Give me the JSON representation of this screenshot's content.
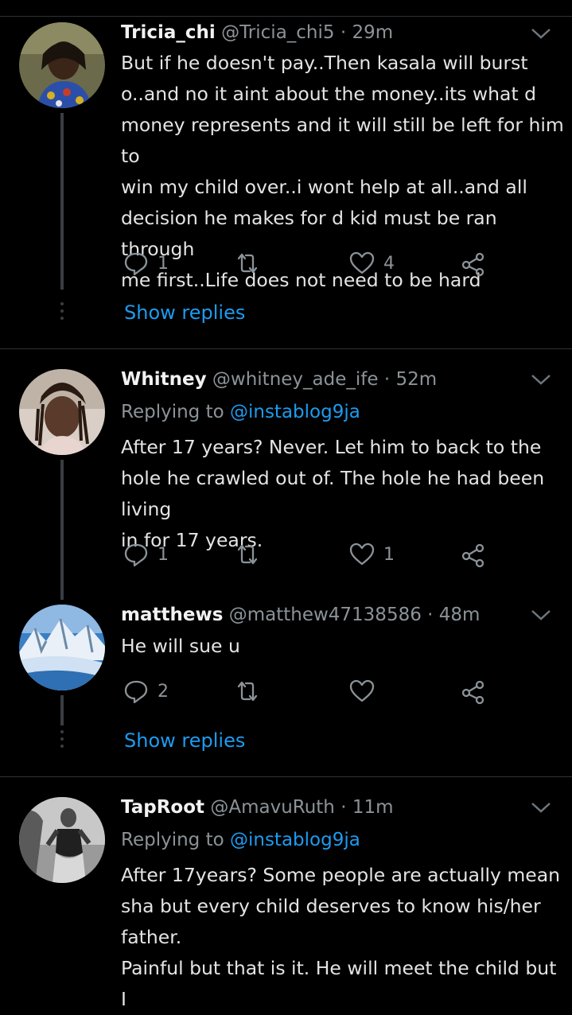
{
  "colors": {
    "background": "#000000",
    "link": "#1d9bf0",
    "muted": "#8b9398",
    "text": "#e4e4e4"
  },
  "tweets": [
    {
      "name": "Tricia_chi",
      "meta": "@Tricia_chi5 · 29m",
      "reply_to_label": "",
      "reply_to_handle": "",
      "lines": [
        "But if he doesn't pay..Then kasala will burst",
        "o..and no it aint about the money..its what d",
        "money represents and it will still be left for him to",
        "win my child over..i wont help at all..and all",
        "decision he makes for d kid must be ran through",
        "me first..Life does not need to be hard"
      ],
      "reply_count": "1",
      "retweet_count": "",
      "like_count": "4",
      "show_replies": "Show replies"
    },
    {
      "name": "Whitney",
      "meta": "@whitney_ade_ife · 52m",
      "reply_to_label": "Replying to",
      "reply_to_handle": "@instablog9ja",
      "lines": [
        "After 17 years? Never. Let him to back to the",
        "hole he crawled out of. The hole he had been living",
        "in for 17 years."
      ],
      "reply_count": "1",
      "retweet_count": "",
      "like_count": "1"
    },
    {
      "name": "matthews",
      "meta": "@matthew47138586 · 48m",
      "lines": [
        "He will sue u"
      ],
      "reply_count": "2",
      "retweet_count": "",
      "like_count": "",
      "show_replies": "Show replies"
    },
    {
      "name": "TapRoot",
      "meta": "@AmavuRuth · 11m",
      "reply_to_label": "Replying to",
      "reply_to_handle": "@instablog9ja",
      "lines": [
        "After 17years? Some people are actually mean",
        "sha but every child deserves to know his/her",
        "father.",
        "Painful but that is it. He will meet the child but I"
      ]
    }
  ],
  "icons": [
    "reply-icon",
    "retweet-icon",
    "like-icon",
    "share-icon",
    "chevron-down-icon"
  ]
}
